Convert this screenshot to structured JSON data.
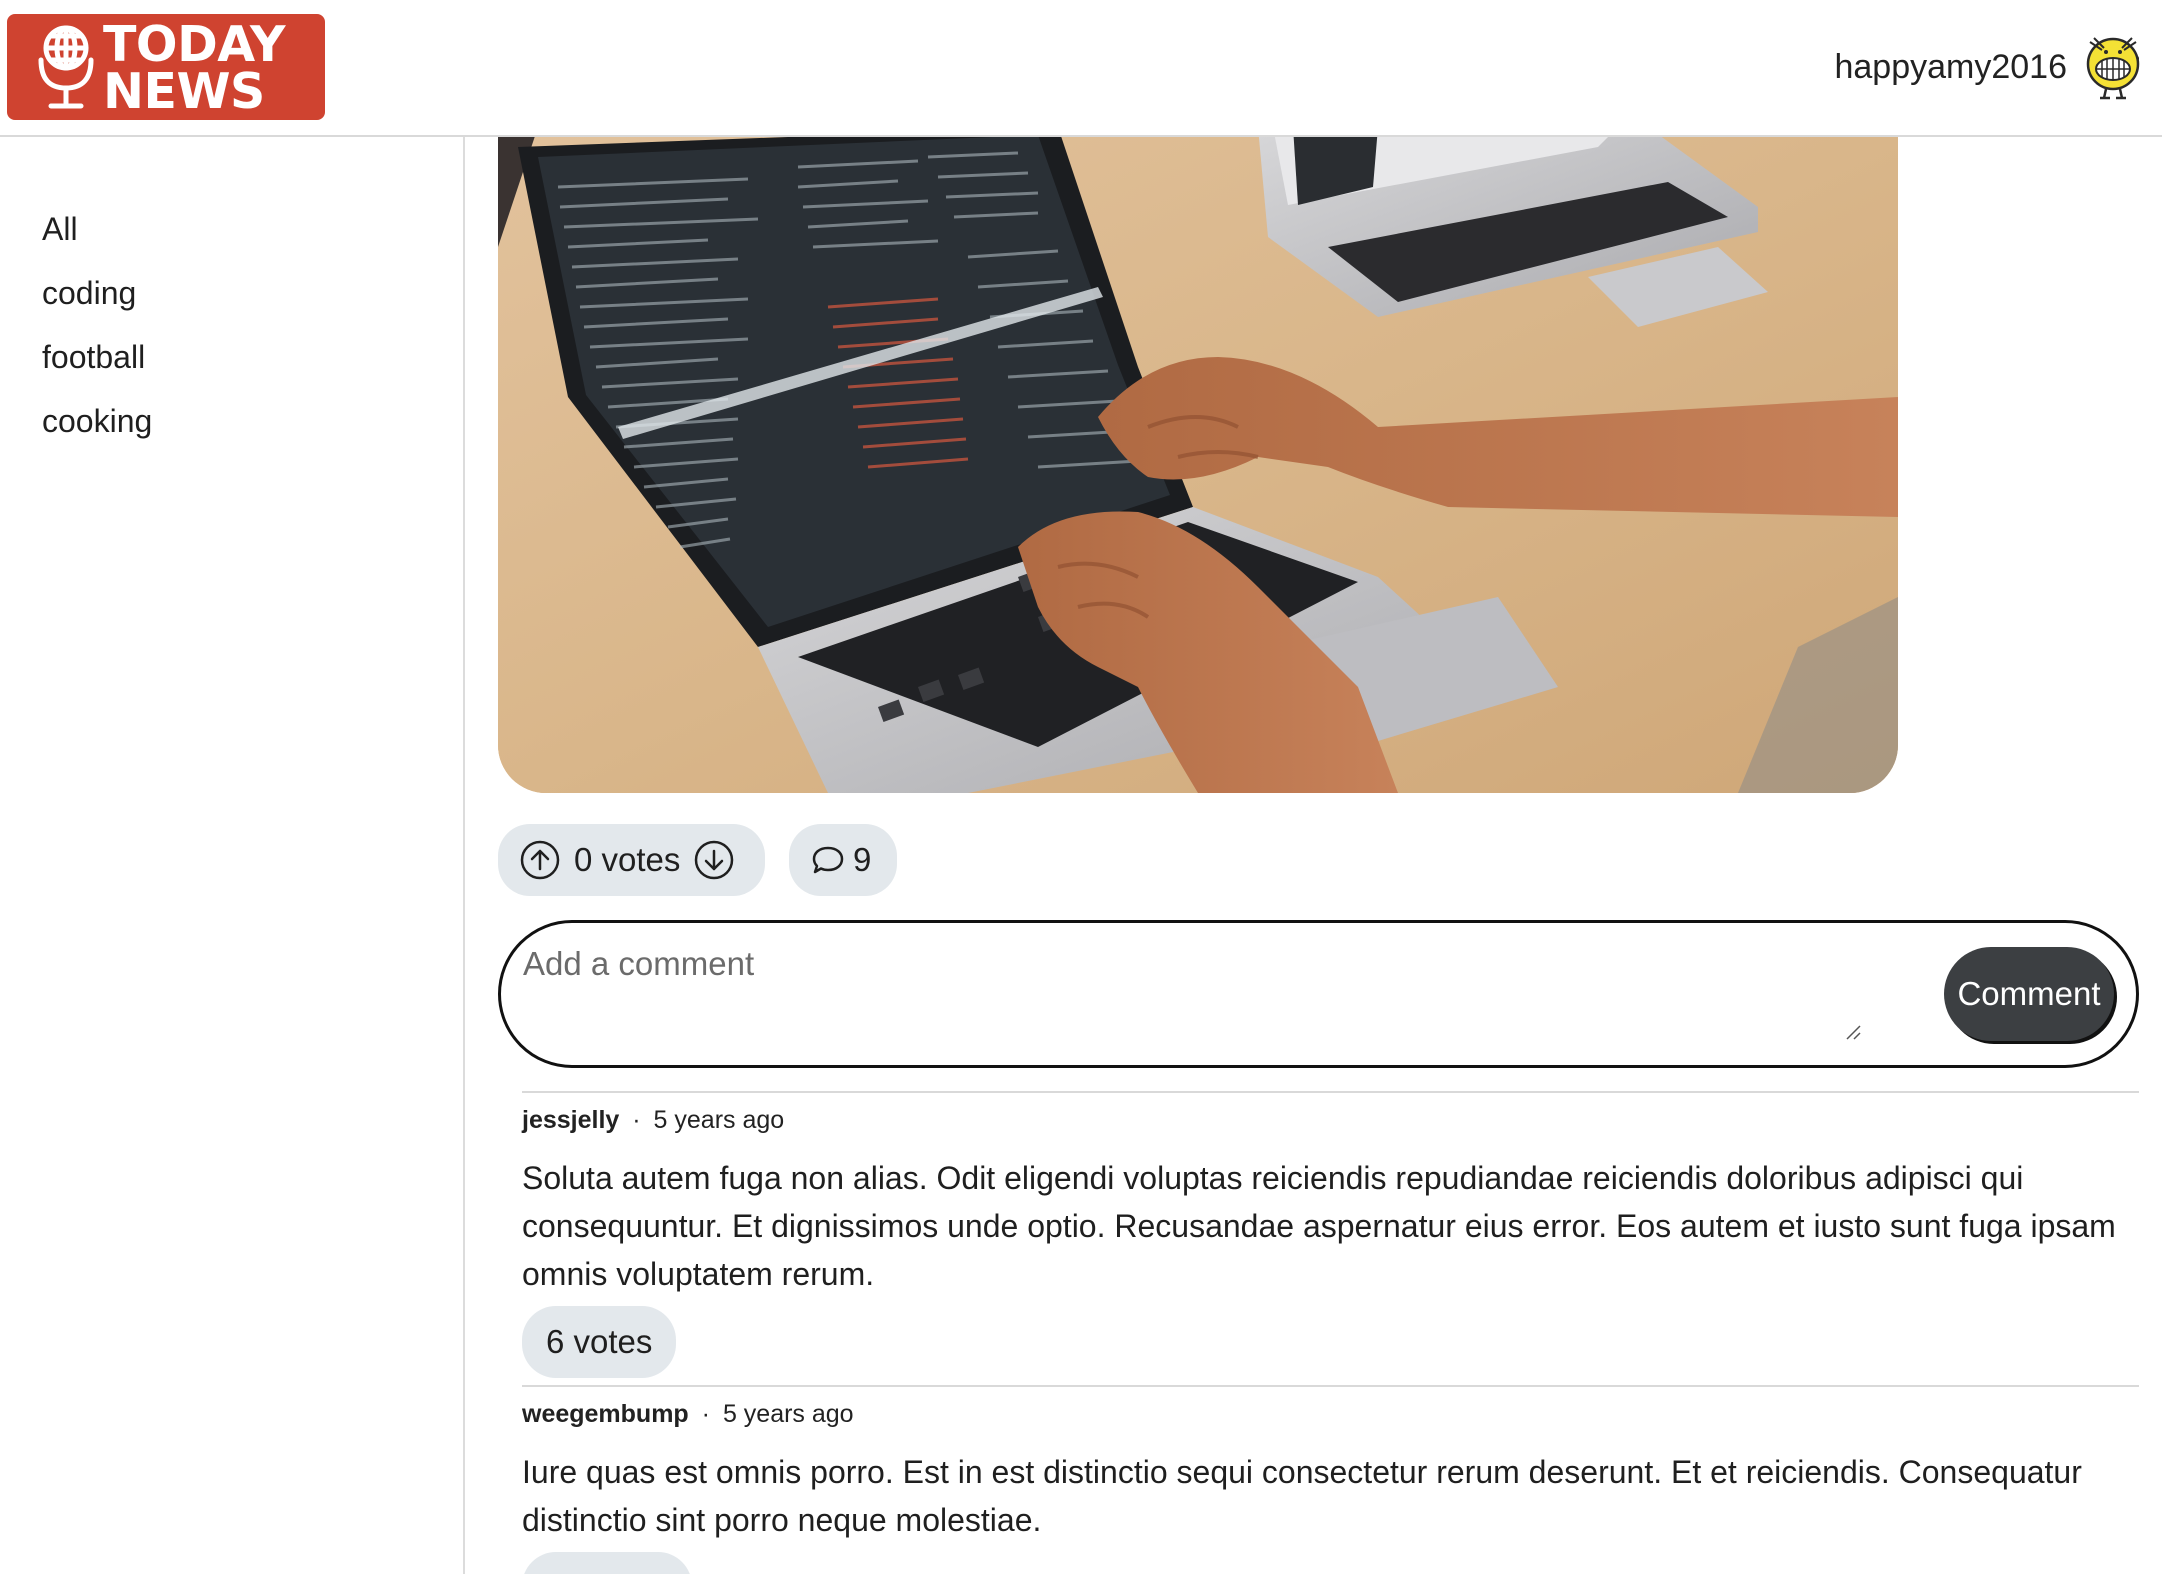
{
  "header": {
    "logo_line1": "TODAY",
    "logo_line2": "NEWS",
    "username": "happyamy2016",
    "brand_color": "#cf4330"
  },
  "sidebar": {
    "items": [
      {
        "label": "All"
      },
      {
        "label": "coding"
      },
      {
        "label": "football"
      },
      {
        "label": "cooking"
      }
    ]
  },
  "post": {
    "votes_label": "0 votes",
    "comment_count": "9"
  },
  "comment_form": {
    "placeholder": "Add a comment",
    "submit_label": "Comment"
  },
  "comments": [
    {
      "author": "jessjelly",
      "separator": "·",
      "time": "5 years ago",
      "body": "Soluta autem fuga non alias. Odit eligendi voluptas reiciendis repudiandae reiciendis doloribus adipisci qui consequuntur. Et dignissimos unde optio. Recusandae aspernatur eius error. Eos autem et iusto sunt fuga ipsam omnis voluptatem rerum.",
      "votes_label": "6 votes"
    },
    {
      "author": "weegembump",
      "separator": "·",
      "time": "5 years ago",
      "body": "Iure quas est omnis porro. Est in est distinctio sequi consectetur rerum deserunt. Et et reiciendis. Consequatur distinctio sint porro neque molestiae."
    }
  ]
}
